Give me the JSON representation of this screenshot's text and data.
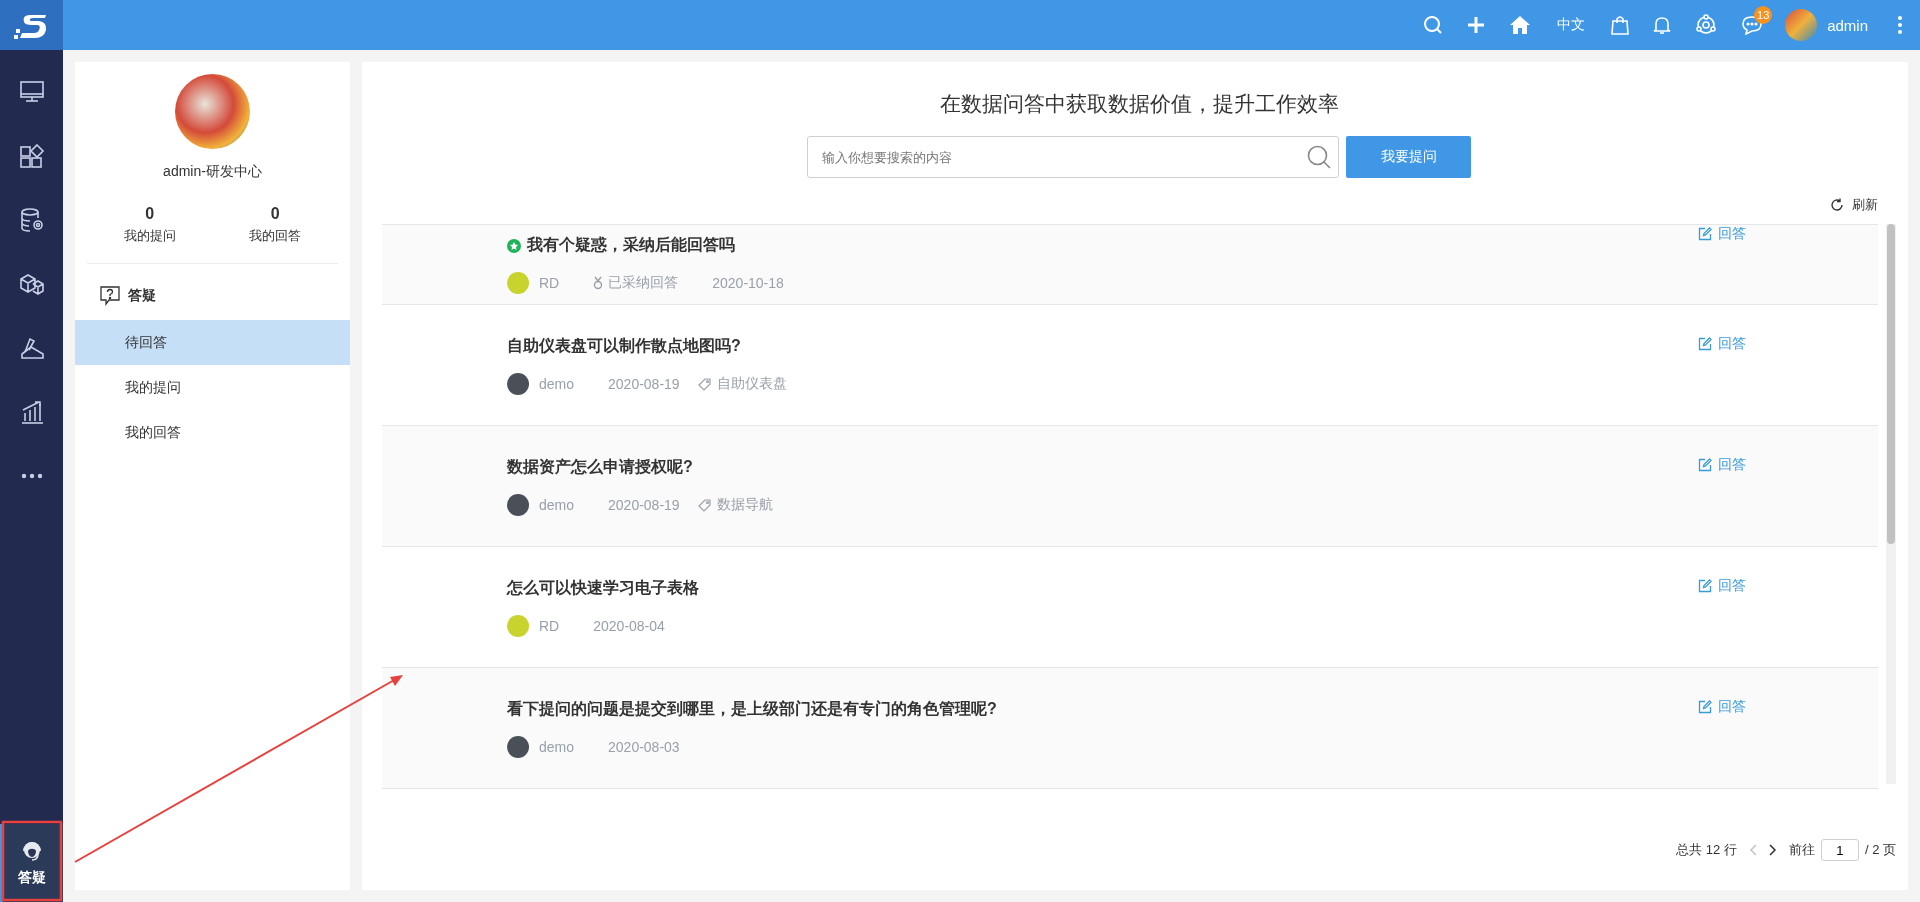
{
  "topbar": {
    "language": "中文",
    "notification_count": "13",
    "username": "admin"
  },
  "nav": {
    "items": [
      {
        "kind": "monitor",
        "selected": false
      },
      {
        "kind": "apps",
        "selected": false
      },
      {
        "kind": "database",
        "selected": false
      },
      {
        "kind": "cubes",
        "selected": false
      },
      {
        "kind": "design",
        "selected": false
      },
      {
        "kind": "chart",
        "selected": false
      },
      {
        "kind": "more",
        "selected": false
      }
    ],
    "bottom": {
      "kind": "headset",
      "label": "答疑",
      "selected": true
    }
  },
  "profile": {
    "name": "admin-研发中心",
    "stats": [
      {
        "value": "0",
        "label": "我的提问"
      },
      {
        "value": "0",
        "label": "我的回答"
      }
    ]
  },
  "menu": {
    "title": "答疑",
    "items": [
      {
        "label": "待回答",
        "selected": true
      },
      {
        "label": "我的提问",
        "selected": false
      },
      {
        "label": "我的回答",
        "selected": false
      }
    ]
  },
  "main": {
    "heading": "在数据问答中获取数据价值，提升工作效率",
    "search": {
      "placeholder": "输入你想要搜索的内容"
    },
    "ask_button": "我要提问",
    "refresh": "刷新"
  },
  "questions": [
    {
      "title": "我有个疑惑，采纳后能回答吗",
      "adopted": true,
      "user": "RD",
      "color": "#c9d32e",
      "status": "已采纳回答",
      "date": "2020-10-18",
      "action": "回答"
    },
    {
      "title": "自助仪表盘可以制作散点地图吗?",
      "adopted": false,
      "user": "demo",
      "color": "#4a5058",
      "date": "2020-08-19",
      "tag": "自助仪表盘",
      "action": "回答"
    },
    {
      "title": "数据资产怎么申请授权呢?",
      "adopted": false,
      "user": "demo",
      "color": "#4a5058",
      "date": "2020-08-19",
      "tag": "数据导航",
      "action": "回答"
    },
    {
      "title": "怎么可以快速学习电子表格",
      "adopted": false,
      "user": "RD",
      "color": "#c9d32e",
      "date": "2020-08-04",
      "action": "回答"
    },
    {
      "title": "看下提问的问题是提交到哪里，是上级部门还是有专门的角色管理呢?",
      "adopted": false,
      "user": "demo",
      "color": "#4a5058",
      "date": "2020-08-03",
      "action": "回答"
    }
  ],
  "pagination": {
    "total": "总共 12 行",
    "prev": {
      "disabled": true
    },
    "next": {
      "disabled": false
    },
    "goto": "前往",
    "page": "1",
    "pages": "/ 2 页"
  }
}
